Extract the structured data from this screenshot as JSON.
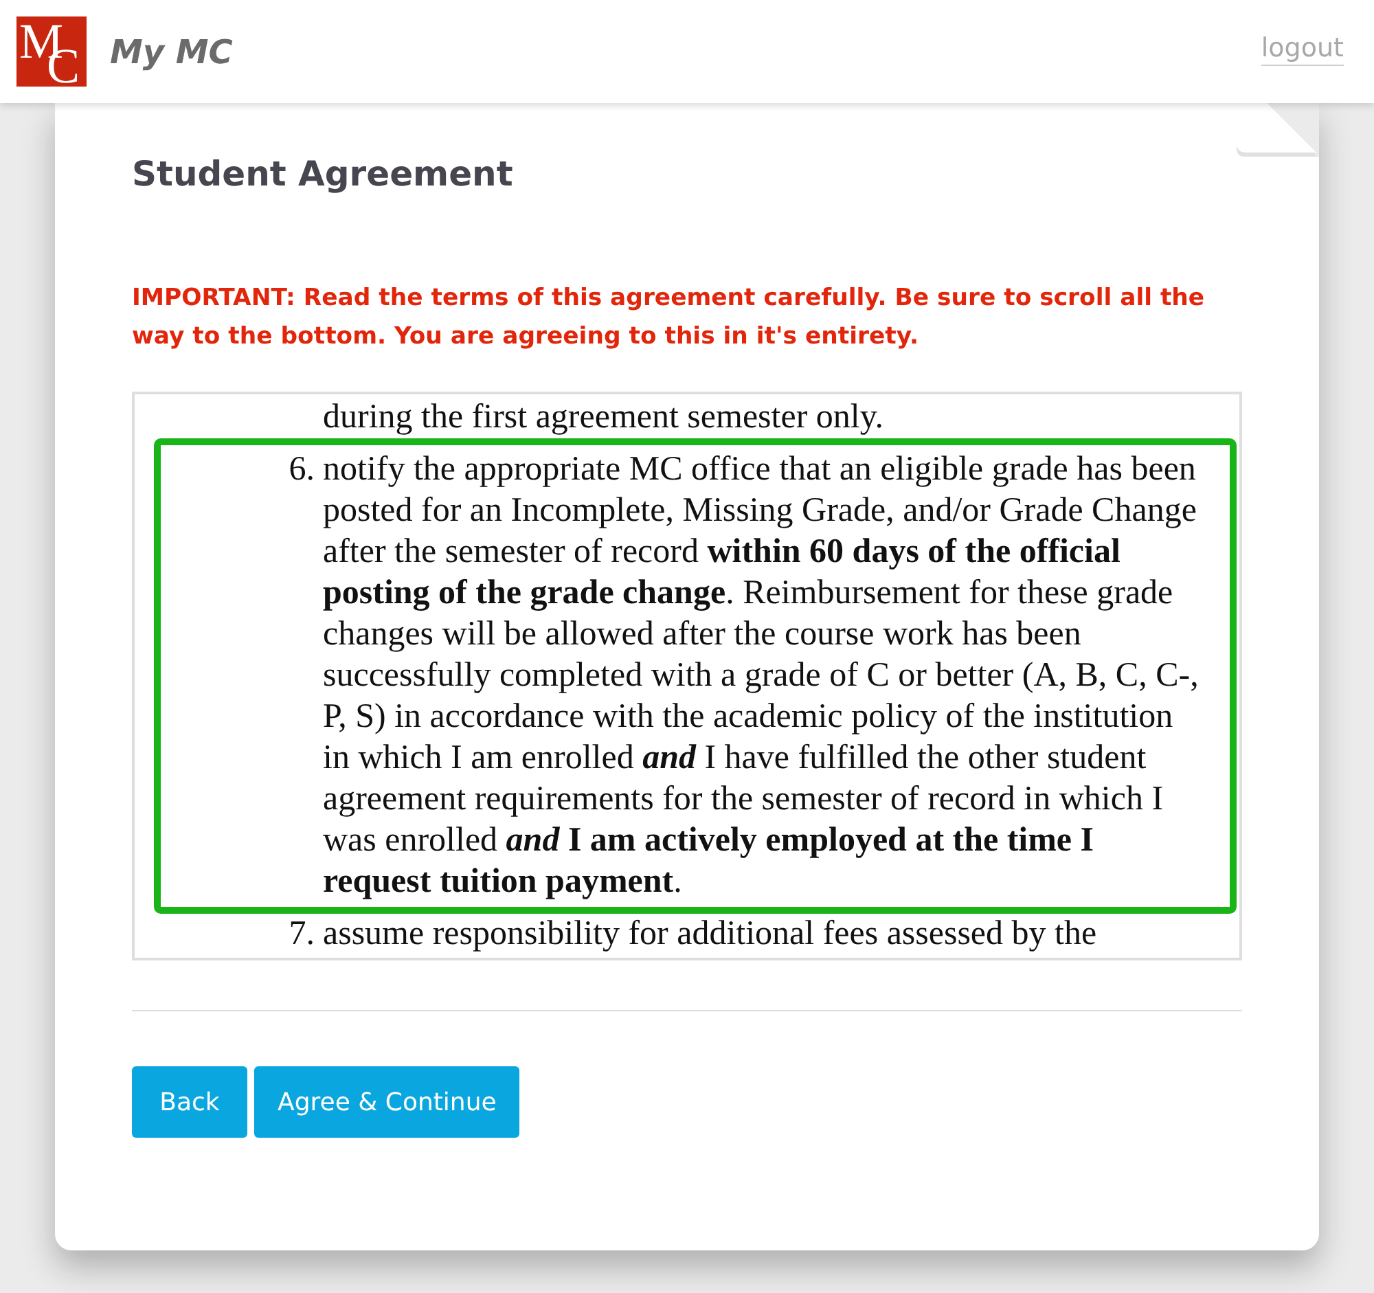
{
  "header": {
    "logo_letters": [
      "M",
      "C"
    ],
    "title": "My MC",
    "logout": "logout"
  },
  "page": {
    "title": "Student Agreement",
    "warning": "IMPORTANT: Read the terms of this agreement carefully. Be sure to scroll all the way to the bottom. You are agreeing to this in it's entirety."
  },
  "agreement": {
    "lead_text": "during the first agreement semester only.",
    "items": [
      {
        "number": "6.",
        "text": "notify the appropriate MC office that an eligible grade has been posted for an Incomplete, Missing Grade, and/or Grade Change after the semester of record **within 60 days of the official posting of the grade change**. Reimbursement for these grade changes will be allowed after the course work has been successfully completed with a grade of C or better (A, B, C, C-, P, S) in accordance with the academic policy of the institution in which I am enrolled *and* I have fulfilled the other student agreement requirements for the semester of record in which I was enrolled *and* **I am actively employed at the time I request tuition payment**.",
        "highlighted": true
      },
      {
        "number": "7.",
        "text": "assume responsibility for additional fees assessed by the",
        "highlighted": false
      }
    ]
  },
  "buttons": [
    "Back",
    "Agree & Continue"
  ]
}
